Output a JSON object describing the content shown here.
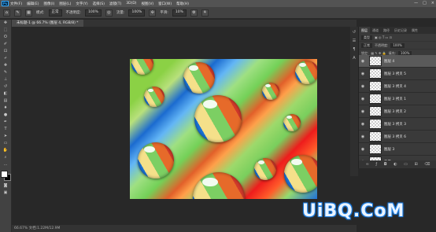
{
  "menubar": {
    "logo": "Ps",
    "items": [
      "文件(F)",
      "编辑(E)",
      "图像(I)",
      "图层(L)",
      "文字(Y)",
      "选择(S)",
      "滤镜(T)",
      "3D(D)",
      "视图(V)",
      "窗口(W)",
      "帮助(H)"
    ],
    "controls": [
      "—",
      "□",
      "×"
    ]
  },
  "options": {
    "mode_label": "模式:",
    "mode_value": "正常",
    "opacity_label": "不透明度:",
    "opacity_value": "100%",
    "flow_label": "流量:",
    "flow_value": "100%",
    "smooth_label": "平滑:",
    "smooth_value": "10%"
  },
  "document": {
    "tab_title": "未标题-1 @ 66.7% (图层 4, RGB/8) *",
    "status": "66.67%    文档:1.22M/12.9M"
  },
  "panel": {
    "tabs": [
      "图层",
      "通道",
      "路径",
      "历史记录",
      "属性"
    ],
    "kind_label": "类型",
    "blend_mode": "正常",
    "opacity_label": "不透明度:",
    "opacity_value": "100%",
    "lock_label": "锁定:",
    "fill_label": "填充:",
    "fill_value": "100%",
    "layers": [
      {
        "name": "图层 4",
        "selected": true
      },
      {
        "name": "图层 3 拷贝 5",
        "selected": false
      },
      {
        "name": "图层 3 拷贝 4",
        "selected": false
      },
      {
        "name": "图层 3 拷贝 1",
        "selected": false
      },
      {
        "name": "图层 3 拷贝 2",
        "selected": false
      },
      {
        "name": "图层 3 拷贝 3",
        "selected": false
      },
      {
        "name": "图层 3 拷贝 6",
        "selected": false
      },
      {
        "name": "图层 3",
        "selected": false
      },
      {
        "name": "背景",
        "selected": false
      }
    ],
    "footer_icons": [
      "link-icon",
      "fx-icon",
      "mask-icon",
      "adjust-icon",
      "folder-icon",
      "new-layer-icon",
      "trash-icon"
    ]
  },
  "watermark": "UiBQ.CoM",
  "colors": {
    "menu_bg": "#535353",
    "workspace_bg": "#282828",
    "panel_bg": "#3a3a3a",
    "selected_layer": "#5a5a5a",
    "watermark_outline": "#1a7be0"
  }
}
